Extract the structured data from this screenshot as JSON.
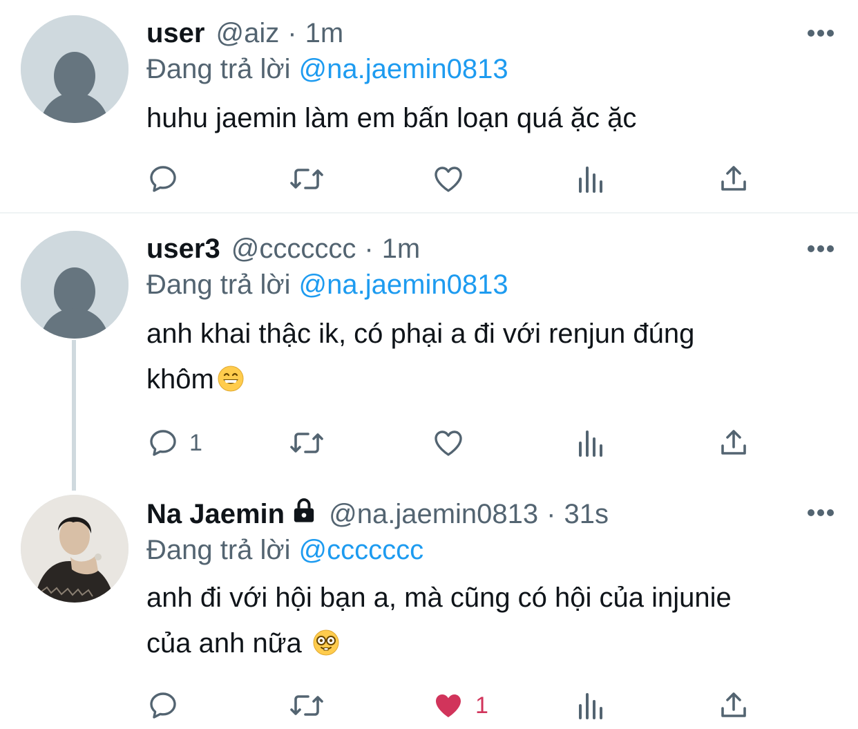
{
  "tweets": [
    {
      "name": "user",
      "handle": "@aiz",
      "dot": "·",
      "time": "1m",
      "reply_prefix": "Đang trả lời",
      "reply_to": "@na.jaemin0813",
      "lines": [
        "huhu jaemin làm em bấn loạn quá ặc ặc"
      ],
      "reply_count": "",
      "like_count": "",
      "liked": false
    },
    {
      "name": "user3",
      "handle": "@ccccccc",
      "dot": "·",
      "time": "1m",
      "reply_prefix": "Đang trả lời",
      "reply_to": "@na.jaemin0813",
      "lines": [
        "anh khai thậc ik, có phại a đi với renjun đúng",
        "khôm"
      ],
      "emoji": "grinning-face-emoji",
      "reply_count": "1",
      "like_count": "",
      "liked": false
    },
    {
      "name": "Na Jaemin",
      "locked": true,
      "handle": "@na.jaemin0813",
      "dot": "·",
      "time": "31s",
      "reply_prefix": "Đang trả lời",
      "reply_to": "@ccccccc",
      "lines": [
        "anh đi với hội bạn a, mà cũng có hội của injunie",
        "của anh nữa"
      ],
      "emoji": "nerd-face-emoji",
      "reply_count": "",
      "like_count": "1",
      "liked": true
    }
  ],
  "colors": {
    "link": "#1d9bf0",
    "secondary_text": "#536471",
    "like_active": "#f91880",
    "like_heart": "#d1345b",
    "icon": "#536471"
  }
}
